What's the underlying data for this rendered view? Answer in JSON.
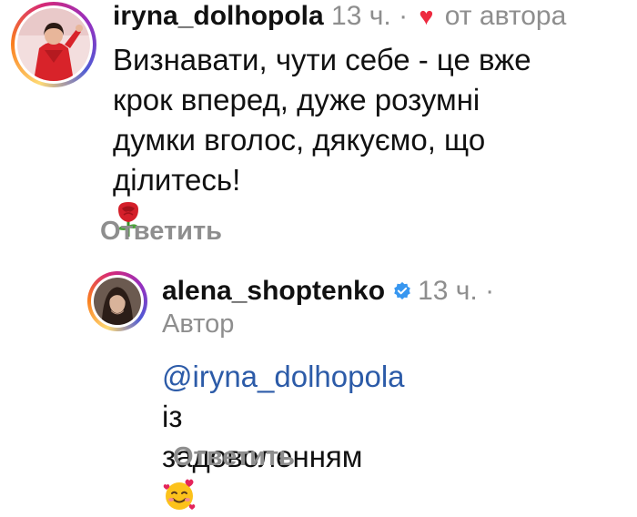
{
  "comment": {
    "avatar_icon": "user-avatar-red-outfit",
    "username": "iryna_dolhopola",
    "time": "13 ч.",
    "separator": "·",
    "liked_by_author_label": "от автора",
    "body_lines": [
      "Визнавати, чути себе - це вже",
      "крок вперед, дуже розумні",
      "думки вголос, дякуємо, що",
      "ділитесь!"
    ],
    "body_emoji": "rose-emoji",
    "reply_label": "Ответить"
  },
  "reply": {
    "avatar_icon": "user-avatar-dark-hair",
    "username": "alena_shoptenko",
    "verified_icon": "verified-badge-icon",
    "time": "13 ч.",
    "separator": "·",
    "author_label": "Автор",
    "mention": "@iryna_dolhopola",
    "body_line1_rest": " із",
    "body_line2": "задоволенням",
    "body_emoji": "smiling-face-with-hearts-emoji",
    "reply_label": "Ответить"
  },
  "colors": {
    "username": "#111111",
    "meta": "#8e8e8e",
    "heart": "#ed2a3f",
    "mention": "#2c5ba8",
    "verified": "#3897f0"
  }
}
